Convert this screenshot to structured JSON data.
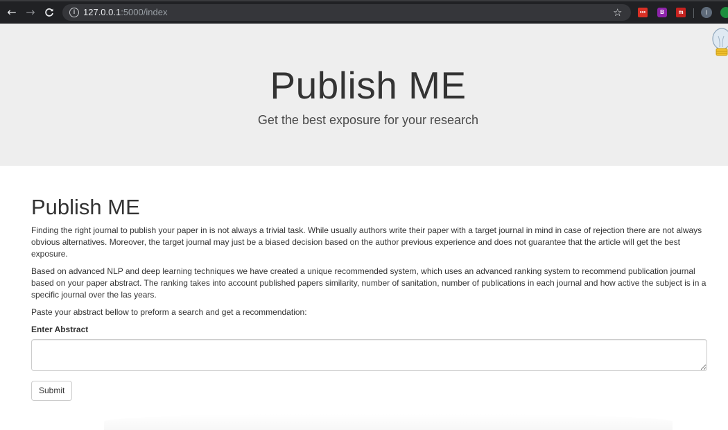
{
  "browser": {
    "url_host": "127.0.0.1",
    "url_path": ":5000/index",
    "back_icon": "←",
    "forward_icon": "→",
    "reload_icon": "C",
    "star_icon": "☆",
    "profile_initial": "I",
    "extension_icons": [
      "password-manager-icon",
      "purple-extension-icon",
      "red-extension-icon",
      "green-extension-icon"
    ]
  },
  "hero": {
    "title": "Publish ME",
    "subtitle": "Get the best exposure for your research"
  },
  "main": {
    "title": "Publish ME",
    "paragraphs": [
      "Finding the right journal to publish your paper in is not always a trivial task. While usually authors write their paper with a target journal in mind in case of rejection there are not always obvious alternatives. Moreover, the target journal may just be a biased decision based on the author previous experience and does not guarantee that the article will get the best exposure.",
      "Based on advanced NLP and deep learning techniques we have created a unique recommended system, which uses an advanced ranking system to recommend publication journal based on your paper abstract. The ranking takes into account published papers similarity, number of sanitation, number of publications in each journal and how active the subject is in a specific journal over the las years.",
      "Paste your abstract bellow to preform a search and get a recommendation:"
    ],
    "form": {
      "label": "Enter Abstract",
      "input_value": "",
      "submit_label": "Submit"
    }
  },
  "colors": {
    "jumbotron_bg": "#eeeeee",
    "toolbar_bg": "#202124",
    "text": "#333333"
  }
}
